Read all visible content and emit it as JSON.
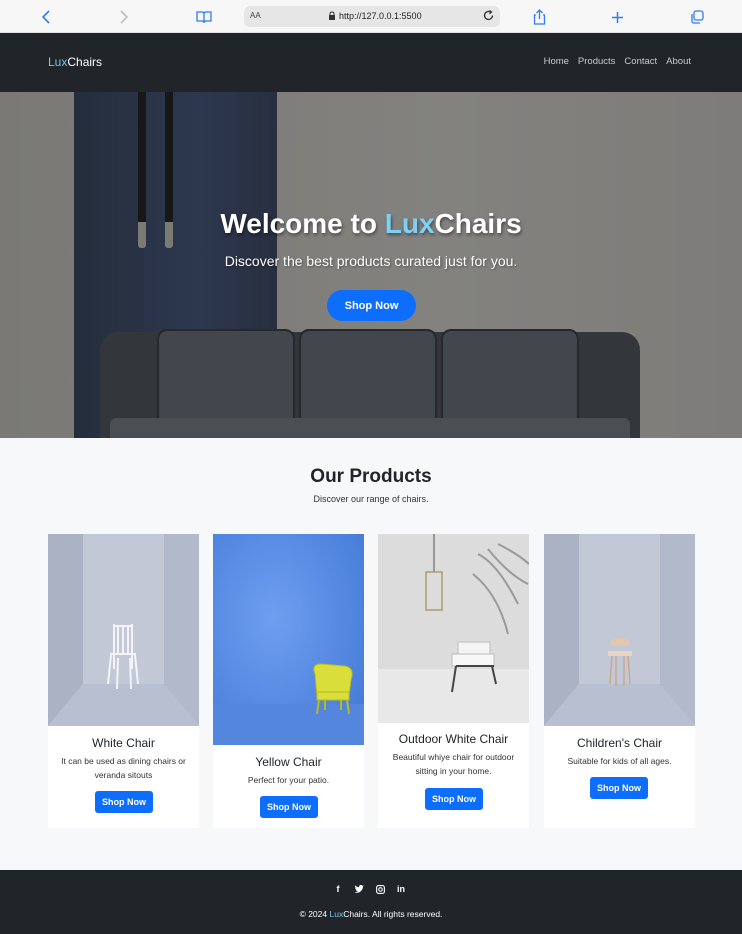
{
  "browser": {
    "text_size_label": "AA",
    "url": "http://127.0.0.1:5500"
  },
  "navbar": {
    "brand_prefix": "Lux",
    "brand_suffix": "Chairs",
    "links": [
      "Home",
      "Products",
      "Contact",
      "About"
    ]
  },
  "hero": {
    "title_prefix": "Welcome to ",
    "title_accent": "Lux",
    "title_suffix": "Chairs",
    "subtitle": "Discover the best products curated just for you.",
    "button": "Shop Now"
  },
  "products": {
    "title": "Our Products",
    "subtitle": "Discover our range of chairs.",
    "items": [
      {
        "name": "White Chair",
        "description": "It can be used as dining chairs or veranda sitouts",
        "button": "Shop Now"
      },
      {
        "name": "Yellow Chair",
        "description": "Perfect for your patio.",
        "button": "Shop Now"
      },
      {
        "name": "Outdoor White Chair",
        "description": "Beautiful whiye chair for outdoor sitting in your home.",
        "button": "Shop Now"
      },
      {
        "name": "Children's Chair",
        "description": "Suitable for kids of all ages.",
        "button": "Shop Now"
      }
    ]
  },
  "footer": {
    "social_icons": [
      "facebook-icon",
      "twitter-icon",
      "instagram-icon",
      "linkedin-icon"
    ],
    "copyright_prefix": "© 2024 ",
    "copyright_brand_prefix": "Lux",
    "copyright_suffix": "Chairs. All rights reserved."
  },
  "colors": {
    "primary": "#0d6efd",
    "navbar_bg": "#212529",
    "brand_accent": "#6ec8f0",
    "page_bg": "#f6f8fa"
  }
}
